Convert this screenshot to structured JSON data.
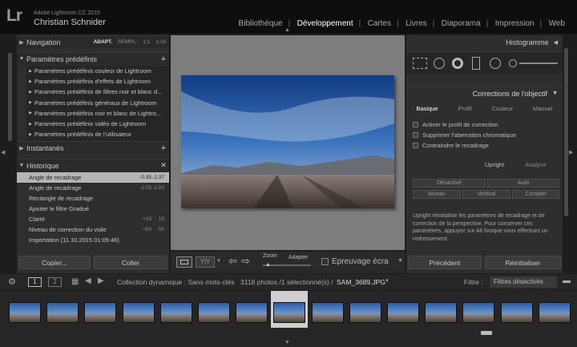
{
  "app": {
    "logo": "Lr",
    "title": "Adobe Lightroom CC 2015",
    "user": "Christian Schnider"
  },
  "modules": [
    "Bibliothèque",
    "Développement",
    "Cartes",
    "Livres",
    "Diaporama",
    "Impression",
    "Web"
  ],
  "active_module": "Développement",
  "left": {
    "navigation": {
      "title": "Navigation",
      "opts": [
        "ADAPT.",
        "REMPL.",
        "1:1",
        "1:16"
      ]
    },
    "presets": {
      "title": "Paramètres prédéfinis",
      "items": [
        "Paramètres prédéfinis couleur de Lightroom",
        "Paramètres prédéfinis d'effets de Lightroom",
        "Paramètres prédéfinis de filtres noir et blanc d...",
        "Paramètres prédéfinis généraux de Lightroom",
        "Paramètres prédéfinis noir et blanc de Lightro...",
        "Paramètres prédéfinis vidéo de Lightroom",
        "Paramètres prédéfinis de l'utilisateur"
      ]
    },
    "snapshots": {
      "title": "Instantanés"
    },
    "history": {
      "title": "Historique",
      "items": [
        {
          "label": "Angle de recadrage",
          "v1": "-0.35",
          "v2": "-2.37"
        },
        {
          "label": "Angle de recadrage",
          "v1": "-2.03",
          "v2": "-2.03"
        },
        {
          "label": "Rectangle de recadrage",
          "v1": "",
          "v2": ""
        },
        {
          "label": "Ajouter le filtre Gradué",
          "v1": "",
          "v2": ""
        },
        {
          "label": "Clarté",
          "v1": "+15",
          "v2": "15"
        },
        {
          "label": "Niveau de correction du voile",
          "v1": "+50",
          "v2": "50"
        },
        {
          "label": "Importation (11.10.2015 01:05:46)",
          "v1": "",
          "v2": ""
        }
      ]
    },
    "copy_btn": "Copier...",
    "paste_btn": "Coller"
  },
  "center_toolbar": {
    "xy": "Y|Y",
    "zoom": "Zoom",
    "fit": "Adapter",
    "softproof": "Epreuvage écra"
  },
  "right": {
    "histogram": {
      "title": "Histogramme"
    },
    "lens": {
      "title": "Corrections de l'objectif",
      "tabs": [
        "Basique",
        "Profil",
        "Couleur",
        "Manuel"
      ],
      "active_tab": "Basique",
      "checks": [
        "Activer le profil de correction",
        "Supprimer l'aberration chromatique",
        "Contraindre le recadrage"
      ],
      "upright": "Upright",
      "analyze": "Analyse",
      "upright_btns": [
        "Désactivé",
        "Auto",
        "Niveau",
        "Vertical",
        "Complet"
      ],
      "info": "Upright réinitialise les paramètres de recadrage et de correction de la perspective. Pour conserver ces paramètres, appuyez sur Alt lorsque vous effectuez un redressement."
    },
    "prev_btn": "Précédent",
    "reset_btn": "Réinitialiser"
  },
  "filmbar": {
    "page1": "1",
    "page2": "2",
    "collection": "Collection dynamique : Sans mots-clés",
    "count": "3118 photos /1 sélectionné(s) /",
    "filename": "SAM_3689.JPG",
    "filter_label": "Filtre :",
    "filter_value": "Filtres désactivés"
  },
  "colors": {
    "accent_active": "#ffffff",
    "panel": "#2e2e2e",
    "selection": "#b5b5b5"
  }
}
